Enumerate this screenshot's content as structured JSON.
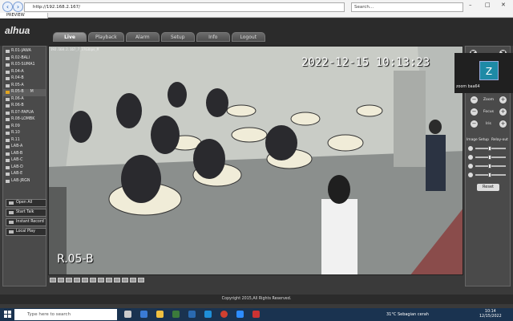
{
  "browser": {
    "address": "http://192.168.2.167/",
    "search_placeholder": "Search...",
    "tab_title": "PREVIEW"
  },
  "app": {
    "logo": "alhua",
    "tabs": [
      "Live",
      "Playback",
      "Alarm",
      "Setup",
      "Info",
      "Logout"
    ],
    "active_tab": "Live"
  },
  "cameras": {
    "items": [
      "R.01-JAWA",
      "R.02-BALI",
      "R.03-SUMA1",
      "R.04-A",
      "R.04-B",
      "R.05-A",
      "R.05-B",
      "R.06-A",
      "R.06-B",
      "R.07-PAPUA",
      "R.08-LOMBK",
      "R.09",
      "R.10",
      "R.11",
      "LAB-A",
      "LAB-B",
      "LAB-C",
      "LAB-D",
      "LAB-E",
      "LAB-JRGN"
    ],
    "selected": "R.05-B",
    "selected_badge": "M"
  },
  "controls": {
    "open_all": "Open All",
    "start_talk": "Start Talk",
    "instant_record": "Instant Record",
    "local_play": "Local Play"
  },
  "video": {
    "info": "192.168.2.167_7_3763bps_M",
    "timestamp": "2022-12-15 10:13:23",
    "label": "R.05-B"
  },
  "zoom_tile": {
    "initial": "Z",
    "name": "zoom baa64",
    "color": "#1e8aa6"
  },
  "ptz": {
    "zoom": "Zoom",
    "focus": "Focus",
    "iris": "Iris",
    "image_setup": "Image Setup",
    "relay_out": "Relay-out",
    "reset": "Reset"
  },
  "footer": {
    "copyright": "Copyright 2015,All Rights Reserved."
  },
  "taskbar": {
    "search_placeholder": "Type here to search",
    "weather": "31°C  Sebagian cerah",
    "time": "10:14",
    "date": "12/15/2022"
  }
}
